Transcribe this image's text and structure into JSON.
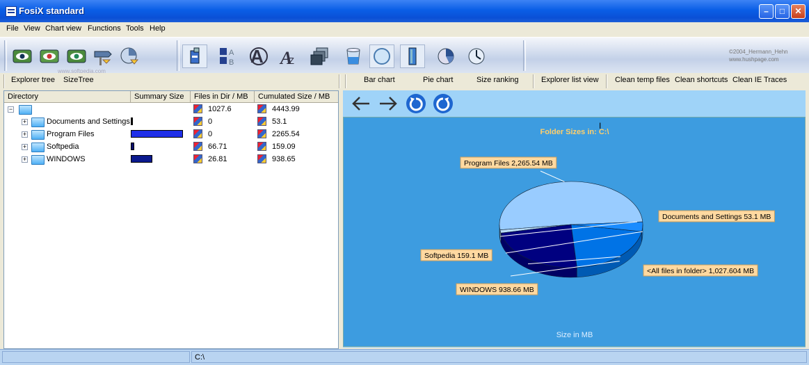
{
  "window": {
    "title": "FosiX standard"
  },
  "menu": [
    "File",
    "View",
    "Chart view",
    "Functions",
    "Tools",
    "Help"
  ],
  "toolbar": {
    "copyright_line1": "©2004_Hermann_Hehn",
    "copyright_line2": "www.hushpage.com",
    "watermark": "www.softpedia.com",
    "icons": [
      "scan-drive-icon",
      "scan-folder-icon",
      "scan-network-icon",
      "export-icon",
      "pie-export-icon",
      "properties-icon",
      "list-view-icon",
      "sort-size-icon",
      "sort-name-icon",
      "layers-icon",
      "bucket-icon",
      "zoom-icon",
      "bar-icon",
      "pie-chart-icon",
      "clock-chart-icon"
    ]
  },
  "tabs": {
    "left": [
      "Explorer tree",
      "SizeTree"
    ],
    "right": [
      "Bar chart",
      "Pie chart",
      "Size ranking",
      "Explorer list view",
      "Clean temp files",
      "Clean shortcuts",
      "Clean IE Traces"
    ]
  },
  "tree": {
    "columns": [
      "Directory",
      "Summary Size",
      "Files in Dir / MB",
      "Cumulated Size / MB"
    ],
    "root": {
      "files": "1027.6",
      "cumulated": "4443.99"
    },
    "rows": [
      {
        "name": "Documents and Settings",
        "files": "0",
        "cumulated": "53.1",
        "fraction": 0.012,
        "bar_color": "#000000"
      },
      {
        "name": "Program Files",
        "files": "0",
        "cumulated": "2265.54",
        "fraction": 0.51,
        "bar_color": "#1f2fe8"
      },
      {
        "name": "Softpedia",
        "files": "66.71",
        "cumulated": "159.09",
        "fraction": 0.036,
        "bar_color": "#0b0f6e"
      },
      {
        "name": "WINDOWS",
        "files": "26.81",
        "cumulated": "938.65",
        "fraction": 0.211,
        "bar_color": "#0b1a8e"
      }
    ]
  },
  "chart_data": {
    "type": "pie",
    "title": "Folder Sizes in: C:\\",
    "xlabel": "Size in MB",
    "slices": [
      {
        "label": "Program Files 2,265.54 MB",
        "value": 2265.54,
        "color": "#99ccff"
      },
      {
        "label": "Documents and Settings 53.1 MB",
        "value": 53.1,
        "color": "#b8dcf8"
      },
      {
        "label": "<All files in folder> 1,027.604 MB",
        "value": 1027.604,
        "color": "#000080"
      },
      {
        "label": "WINDOWS 938.66 MB",
        "value": 938.66,
        "color": "#0073e6"
      },
      {
        "label": "Softpedia 159.1 MB",
        "value": 159.1,
        "color": "#1a8cff"
      }
    ]
  },
  "status": {
    "path": "C:\\"
  }
}
